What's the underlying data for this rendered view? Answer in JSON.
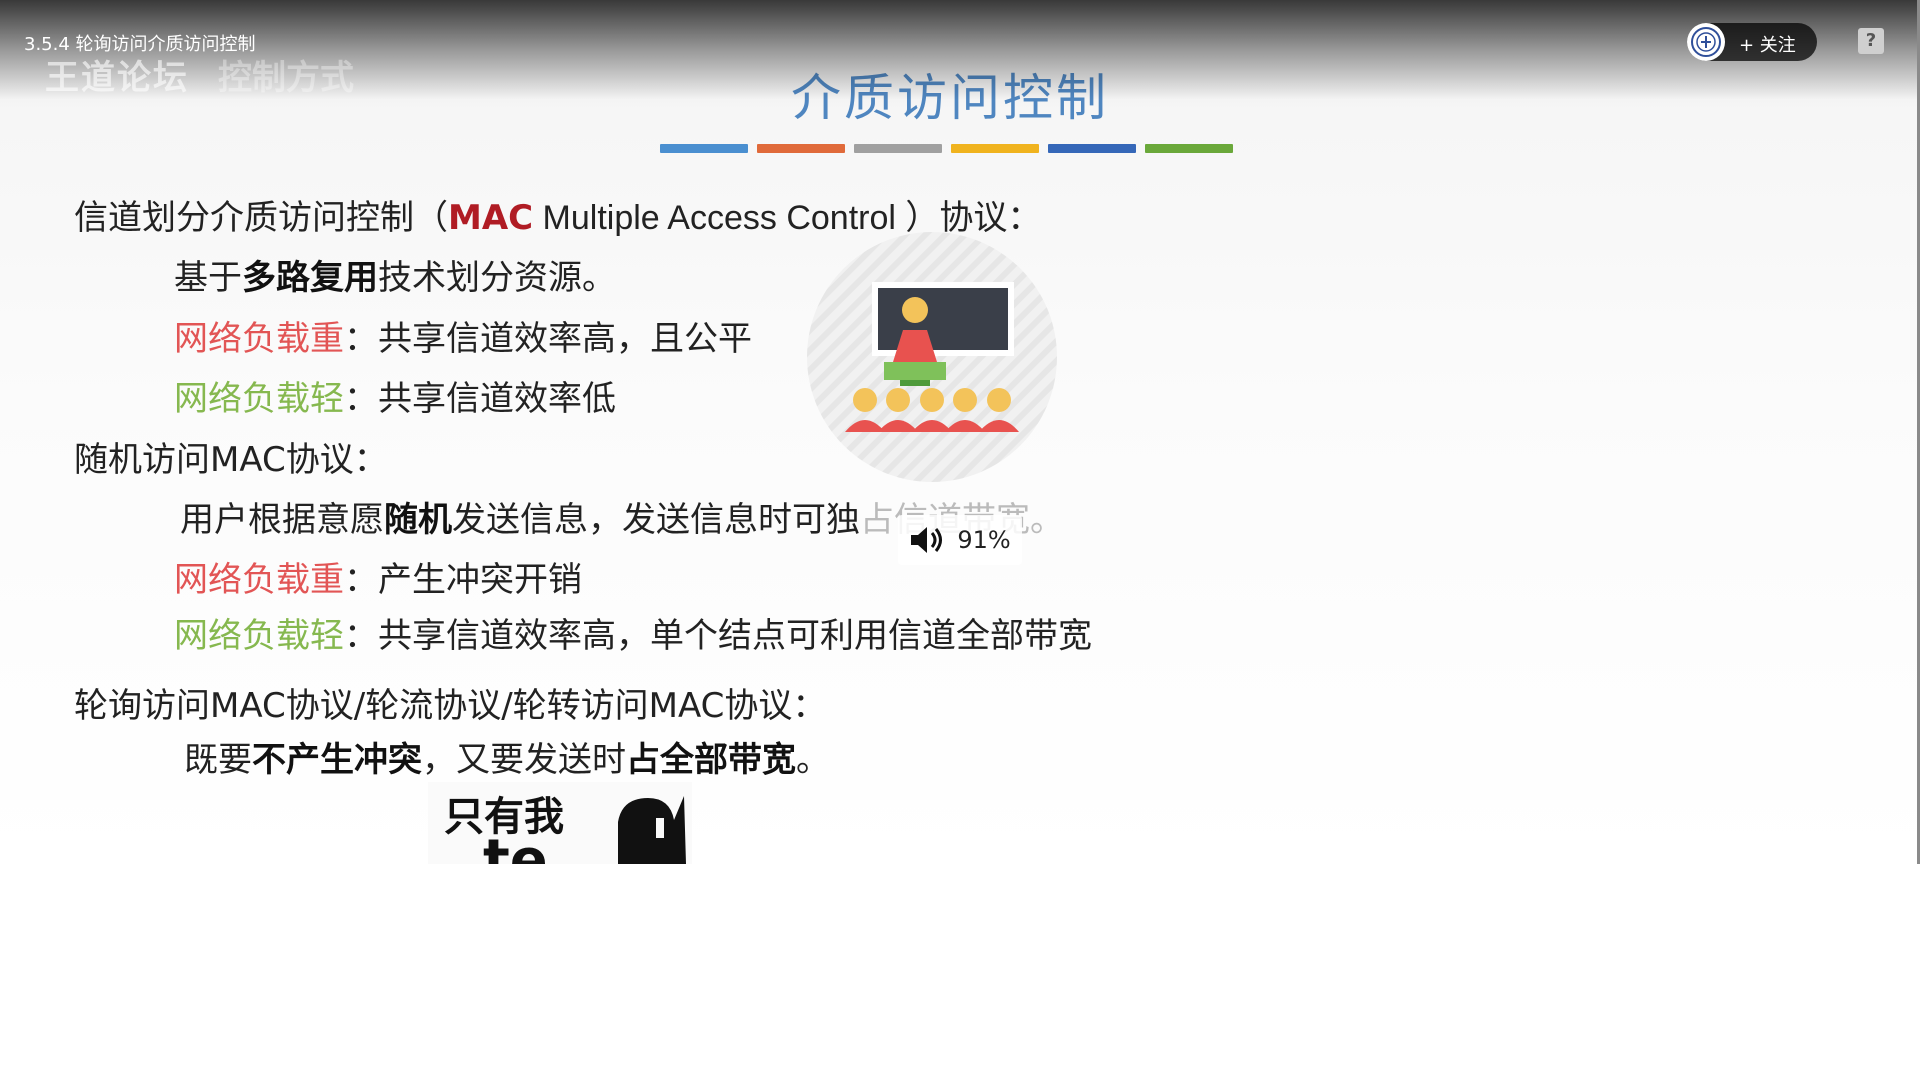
{
  "player": {
    "video_title": "3.5.4 轮询访问介质访问控制",
    "watermark": "王道论坛",
    "watermark_secondary": "控制方式",
    "follow_label": "+ 关注",
    "help_label": "?"
  },
  "slide": {
    "title": "介质访问控制",
    "bar_colors": [
      "#4a8fd0",
      "#e06a3a",
      "#a0a0a0",
      "#f0b31e",
      "#3567b8",
      "#6aa83a"
    ],
    "s1": {
      "prefix": "信道划分介质访问控制（",
      "mac": "MAC",
      "middle": " Multiple Access Control ",
      "suffix": "）协议："
    },
    "s1_line1": {
      "a": "基于",
      "b": "多路复用",
      "c": "技术划分资源。"
    },
    "s1_heavy": {
      "label": "网络负载重",
      "text": "：共享信道效率高，且公平"
    },
    "s1_light": {
      "label": "网络负载轻",
      "text": "：共享信道效率低"
    },
    "s2": {
      "heading": "随机访问MAC协议："
    },
    "s2_line1": {
      "a": "用户根据意愿",
      "b": "随机",
      "c": "发送信息，发送信息时可独",
      "d": "占信道带宽。"
    },
    "s2_heavy": {
      "label": "网络负载重",
      "text": "：产生冲突开销"
    },
    "s2_light": {
      "label": "网络负载轻",
      "text": "：共享信道效率高，单个结点可利用信道全部带宽"
    },
    "s3": {
      "heading": "轮询访问MAC协议/轮流协议/轮转访问MAC协议："
    },
    "s3_line1": {
      "a": "既要",
      "b": "不产生冲突",
      "c": "，又要发送时",
      "d": "占全部带宽",
      "e": "。"
    },
    "sticker_text": "只有我",
    "sticker_text2": "te"
  },
  "volume": {
    "value": "91%",
    "icon": "speaker-icon"
  }
}
